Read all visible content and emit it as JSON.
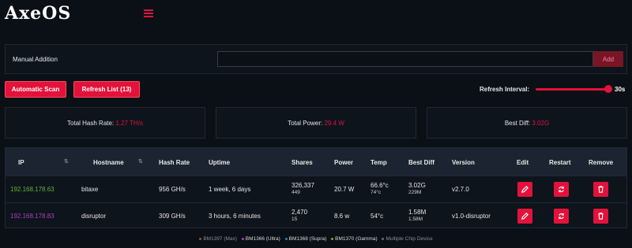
{
  "app": {
    "logo": "AxeOS"
  },
  "manual": {
    "label": "Manual Addition",
    "input_value": "",
    "input_placeholder": "",
    "add_label": "Add"
  },
  "actions": {
    "scan_label": "Automatic Scan",
    "refresh_label": "Refresh List (13)",
    "interval_label": "Refresh Interval:",
    "interval_value": "30s",
    "interval_fraction": 1.0
  },
  "stats": {
    "hash_label": "Total Hash Rate:",
    "hash_value": "1.27 TH/s",
    "power_label": "Total Power:",
    "power_value": "29.4 W",
    "diff_label": "Best Diff:",
    "diff_value": "3.02G"
  },
  "table": {
    "headers": [
      "IP",
      "Hostname",
      "Hash Rate",
      "Uptime",
      "Shares",
      "Power",
      "Temp",
      "Best Diff",
      "Version",
      "Edit",
      "Restart",
      "Remove"
    ],
    "rows": [
      {
        "ip": "192.168.178.63",
        "ip_color": "#5fb43a",
        "hostname": "bitaxe",
        "hashrate": "956 GH/s",
        "uptime": "1 week, 6 days",
        "shares": "326,337",
        "shares_sub": "449",
        "power": "20.7 W",
        "temp": "66.6°c",
        "temp_sub": "74°c",
        "bestdiff": "3.02G",
        "bestdiff_sub": "229M",
        "version": "v2.7.0"
      },
      {
        "ip": "192.168.178.83",
        "ip_color": "#b03ec0",
        "hostname": "disruptor",
        "hashrate": "309 GH/s",
        "uptime": "3 hours, 6 minutes",
        "shares": "2,470",
        "shares_sub": "15",
        "power": "8.6 w",
        "temp": "54°c",
        "temp_sub": "",
        "bestdiff": "1.58M",
        "bestdiff_sub": "1.58M",
        "version": "v1.0-disruptor"
      }
    ]
  },
  "legend": [
    {
      "label": "BM1397 (Max)",
      "color": "#8a5a2a"
    },
    {
      "label": "BM1366 (Ultra)",
      "color": "#b03ec0"
    },
    {
      "label": "BM1368 (Supra)",
      "color": "#3a7ab8"
    },
    {
      "label": "BM1370 (Gamma)",
      "color": "#5fb43a"
    },
    {
      "label": "Multiple Chip Device",
      "color": "#6a6a6a"
    }
  ],
  "colors": {
    "accent": "#e3123a",
    "background": "#0b1017",
    "panel": "#0e141c"
  },
  "icons": {
    "menu": "hamburger-icon",
    "edit": "pencil-icon",
    "restart": "sync-icon",
    "remove": "trash-icon",
    "sort": "sort-arrows-icon"
  }
}
